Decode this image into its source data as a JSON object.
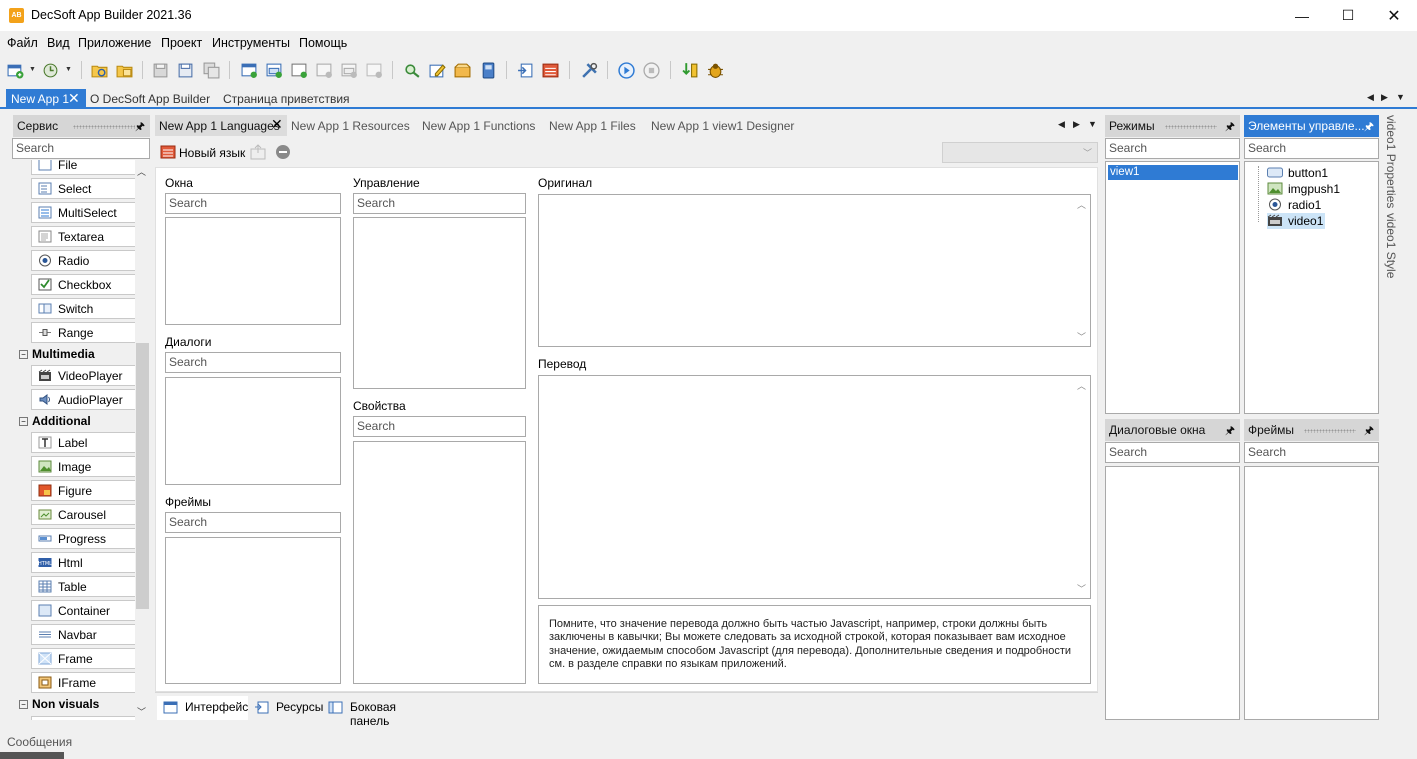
{
  "window": {
    "title": "DecSoft App Builder 2021.36",
    "logo": "AB"
  },
  "window_controls": {
    "minimize": "—",
    "maximize": "☐",
    "close": "✕"
  },
  "menu": [
    "Файл",
    "Вид",
    "Приложение",
    "Проект",
    "Инструменты",
    "Помощь"
  ],
  "document_tabs": {
    "active": "New App 1",
    "others": [
      "О DecSoft App Builder",
      "Страница приветствия"
    ]
  },
  "left_panel": {
    "title": "Сервис",
    "search_placeholder": "Search",
    "items": [
      "File",
      "Select",
      "MultiSelect",
      "Textarea",
      "Radio",
      "Checkbox",
      "Switch",
      "Range"
    ],
    "multimedia": {
      "title": "Multimedia",
      "items": [
        "VideoPlayer",
        "AudioPlayer"
      ]
    },
    "additional": {
      "title": "Additional",
      "items": [
        "Label",
        "Image",
        "Figure",
        "Carousel",
        "Progress",
        "Html",
        "Table",
        "Container",
        "Navbar",
        "Frame",
        "IFrame"
      ]
    },
    "non_visuals": {
      "title": "Non visuals"
    }
  },
  "editor_tabs": [
    "New App 1 Languages",
    "New App 1 Resources",
    "New App 1 Functions",
    "New App 1 Files",
    "New App 1 view1 Designer"
  ],
  "languages": {
    "new_language": "Новый язык",
    "windows_label": "Окна",
    "dialogs_label": "Диалоги",
    "frames_label": "Фреймы",
    "controls_label": "Управление",
    "properties_label": "Свойства",
    "original_label": "Оригинал",
    "translation_label": "Перевод",
    "search_placeholder": "Search",
    "hint": "Помните, что значение перевода должно быть частью Javascript, например, строки должны быть заключены в кавычки; Вы можете следовать за исходной строкой, которая показывает вам исходное значение, ожидаемым способом Javascript (для перевода). Дополнительные сведения и подробности см. в разделе справки по языкам приложений."
  },
  "bottom_tabs": [
    "Интерфейс",
    "Ресурсы",
    "Боковая панель"
  ],
  "modes_panel": {
    "title": "Режимы",
    "search_placeholder": "Search",
    "items": [
      "view1"
    ]
  },
  "controls_panel": {
    "title": "Элементы управле...",
    "search_placeholder": "Search",
    "items": [
      "button1",
      "imgpush1",
      "radio1",
      "video1"
    ]
  },
  "dialogs_panel": {
    "title": "Диалоговые окна",
    "search_placeholder": "Search"
  },
  "frames_panel": {
    "title": "Фреймы",
    "search_placeholder": "Search"
  },
  "side_tabs": [
    "video1 Properties",
    "video1 Style"
  ],
  "status": "Сообщения",
  "colors": {
    "accent": "#2f7bd4",
    "panel_header": "#d6d6d6",
    "background": "#f0f0f0"
  }
}
